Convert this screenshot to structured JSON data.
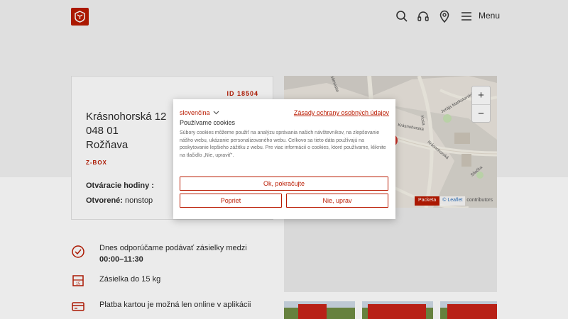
{
  "header": {
    "menu_label": "Menu",
    "icons": [
      "logo-icon",
      "search-icon",
      "headset-icon",
      "location-pin-icon",
      "hamburger-icon"
    ]
  },
  "point": {
    "id_label": "ID 18504",
    "street": "Krásnohorská 12",
    "postcode": "048 01",
    "city": "Rožňava",
    "type": "Z-BOX",
    "hours_label": "Otváracie hodiny :",
    "open_label": "Otvorené:",
    "open_value": "nonstop"
  },
  "map": {
    "zoom_in": "+",
    "zoom_out": "−",
    "attribution_brand": "Packeta",
    "attribution_leaflet": "© Leaflet",
    "attribution_contributors": "contributors",
    "streets": [
      "Krásnohorská",
      "Krásnohorská",
      "Jurája Markulovského",
      "Kosa",
      "Sliačka",
      "Námestie"
    ]
  },
  "info": {
    "recommend_text": "Dnes odporúčame podávať zásielky medzi",
    "recommend_time": "00:00–11:30",
    "weight_text": "Zásielka do 15 kg",
    "weight_icon_label": "15",
    "payment_text": "Platba kartou je možná len online v aplikácii"
  },
  "cookie_modal": {
    "language": "slovenčina",
    "policy_link": "Zásady ochrany osobných údajov",
    "title": "Používame cookies",
    "text": "Súbory cookies môžeme použiť na analýzu správania našich návštevníkov, na zlepšovanie nášho webu, ukázanie personalizovaného webu. Celkovo sa tieto dáta používajú na poskytovanie lepšieho zážitku z webu. Pre viac informácií o cookies, ktoré používame, kliknite na tlačidlo „Nie, upraviť\".",
    "accept_button": "Ok, pokračujte",
    "reject_button": "Popriet",
    "customize_button": "Nie, uprav"
  },
  "colors": {
    "brand": "#ba1b02",
    "background_top": "#f2f2f2",
    "text": "#2b2b2b"
  }
}
